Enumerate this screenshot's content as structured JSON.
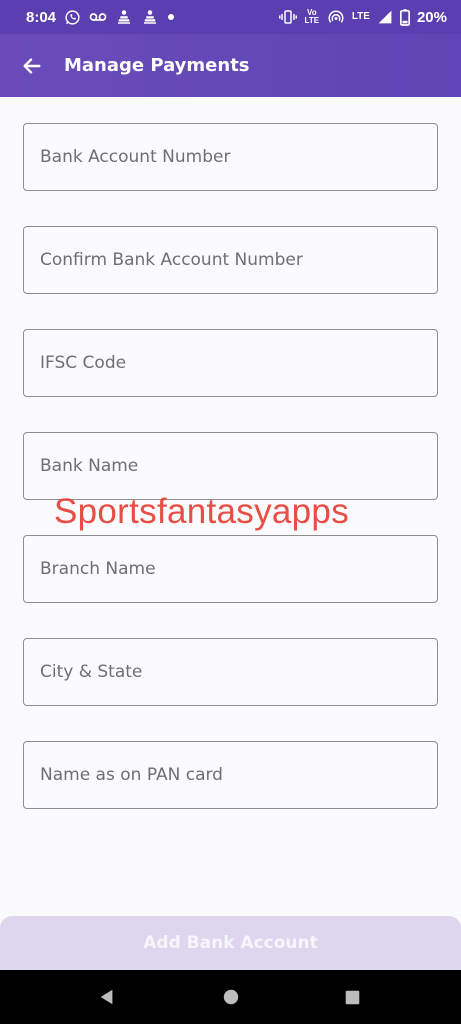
{
  "status_bar": {
    "time": "8:04",
    "battery_percent": "20%",
    "network_label": "LTE",
    "volte_label": "Vo LTE",
    "icons": [
      "whatsapp-icon",
      "voicemail-icon",
      "app-icon",
      "app-icon",
      "dot-icon",
      "vibrate-icon",
      "volte-icon",
      "hotspot-icon",
      "signal-icon",
      "battery-icon"
    ]
  },
  "app_bar": {
    "title": "Manage Payments",
    "back_icon": "arrow-left-icon"
  },
  "form": {
    "fields": [
      {
        "placeholder": "Bank Account Number",
        "value": ""
      },
      {
        "placeholder": "Confirm Bank Account Number",
        "value": ""
      },
      {
        "placeholder": "IFSC Code",
        "value": ""
      },
      {
        "placeholder": "Bank Name",
        "value": ""
      },
      {
        "placeholder": "Branch Name",
        "value": ""
      },
      {
        "placeholder": "City & State",
        "value": ""
      },
      {
        "placeholder": "Name as on PAN card",
        "value": ""
      }
    ]
  },
  "watermark": "Sportsfantasyapps",
  "add_button": {
    "label": "Add Bank Account"
  },
  "nav_bar": {
    "icons": [
      "back-triangle-icon",
      "home-circle-icon",
      "recents-square-icon"
    ]
  },
  "colors": {
    "primary": "#5f45b5",
    "status_bar": "#5b3fb0",
    "button_disabled_bg": "#ddd6ee",
    "watermark": "#e8453c",
    "field_border": "#8e8e96"
  }
}
